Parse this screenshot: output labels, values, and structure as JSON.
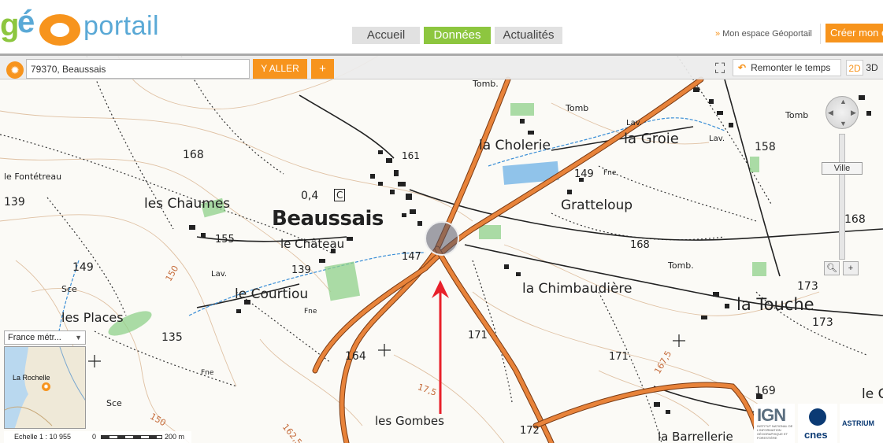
{
  "header": {
    "logo_geo": "géo",
    "logo_portail": "portail",
    "nav": [
      {
        "label": "Accueil",
        "active": false
      },
      {
        "label": "Données",
        "active": true
      },
      {
        "label": "Actualités",
        "active": false
      }
    ],
    "espace_label": "Mon espace Géoportail",
    "create_label": "Créer mon e"
  },
  "toolbar": {
    "search_value": "79370, Beaussais",
    "go_label": "Y ALLER",
    "plus_label": "+",
    "remonter_label": "Remonter le temps",
    "view_2d": "2D",
    "view_3d": "3D"
  },
  "controls": {
    "zoom_level_label": "Ville"
  },
  "overview": {
    "region_select": "France métr...",
    "place_label": "La Rochelle"
  },
  "scale": {
    "text": "Echelle 1 :  10 955",
    "zero": "0",
    "distance": "200 m"
  },
  "map_labels": {
    "beaussais": "Beaussais",
    "le_chateau": "le Château",
    "les_chaumes": "les Chaumes",
    "le_courtiou": "le Courtiou",
    "les_places": "les Places",
    "la_cholerie": "la Cholerie",
    "la_groie": "la Groie",
    "gratteloup": "Gratteloup",
    "la_chimbaudiere": "la Chimbaudière",
    "la_touche": "la Touche",
    "les_gombes": "les  Gombes",
    "la_barrellerie": "la Barrellerie",
    "fontetreau": "le Fontétreau",
    "le_c": "le C",
    "tomb1": "Tomb.",
    "tomb2": "Tomb",
    "tomb3": "Tomb",
    "tomb4": "Tomb.",
    "lav1": "Lav.",
    "lav2": "Lav.",
    "lav3": "Lav.",
    "fne1": "Fne",
    "fne2": "Fne",
    "fne3": "Fne",
    "sce1": "Sce",
    "sce2": "Sce",
    "e168a": "168",
    "e168b": "168",
    "e168c": "168",
    "e161": "161",
    "e158": "158",
    "e149a": "149",
    "e149b": "149",
    "e155": "155",
    "e147": "147",
    "e139a": "139",
    "e139b": "139",
    "e135": "135",
    "e164": "164",
    "e171a": "171",
    "e171b": "171",
    "e172": "172",
    "e173a": "173",
    "e173b": "173",
    "e169": "169",
    "e04": "0,4",
    "c_box": "C",
    "contour150": "150",
    "contour1675": "167,5",
    "contour175": "17,5",
    "contour1625": "162,5",
    "contour150b": "150"
  },
  "colors": {
    "orange": "#f7941d",
    "green": "#8dc63f",
    "blue": "#5aa9d6",
    "road": "#e8833a",
    "arrow": "#e8202a"
  },
  "icons": {
    "location": "location-target-icon",
    "fullscreen": "fullscreen-icon",
    "undo": "undo-arrow-icon"
  }
}
